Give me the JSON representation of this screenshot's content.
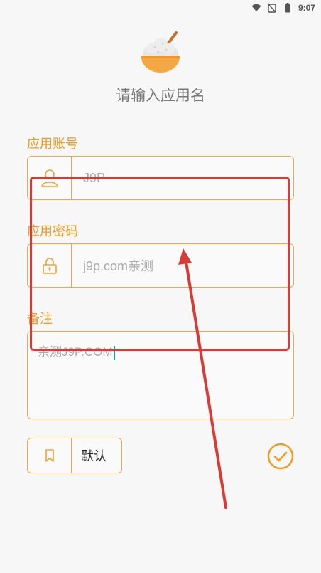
{
  "status_bar": {
    "time": "9:07",
    "icons": [
      "wifi-icon",
      "no-signal-icon",
      "battery-icon"
    ]
  },
  "header": {
    "logo": "rice-bowl-icon",
    "title": "请输入应用名"
  },
  "account": {
    "label": "应用账号",
    "value": "J9P",
    "icon": "user-icon"
  },
  "password": {
    "label": "应用密码",
    "value": "j9p.com亲测",
    "icon": "lock-icon"
  },
  "note": {
    "label": "备注",
    "value": "亲测J9P.COM"
  },
  "default_button": {
    "label": "默认",
    "icon": "bookmark-icon"
  },
  "confirm_button": {
    "icon": "check-circle-icon"
  },
  "colors": {
    "accent": "#f6a640",
    "label": "#f39a1e",
    "annotation": "#d93a33"
  }
}
